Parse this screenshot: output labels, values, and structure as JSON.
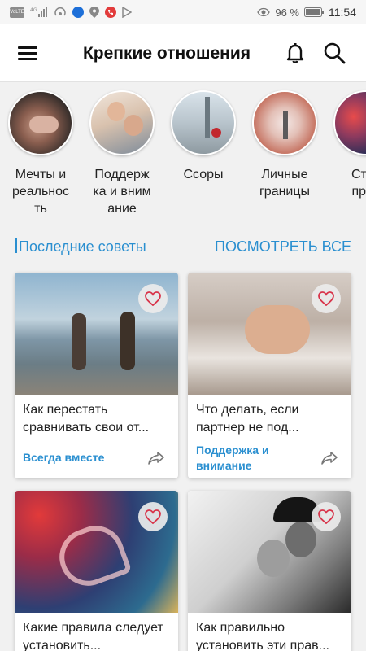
{
  "status_bar": {
    "signal_text": "VoLTE",
    "network": "4G",
    "battery": "96 %",
    "time": "11:54"
  },
  "header": {
    "title": "Крепкие отношения"
  },
  "categories": [
    {
      "label": "Мечты и\nреальнос\nть"
    },
    {
      "label": "Поддерж\nка и вним\nание"
    },
    {
      "label": "Ссоры"
    },
    {
      "label": "Личные\nграницы"
    },
    {
      "label": "Став\nправ"
    }
  ],
  "section": {
    "title": "Последние советы",
    "see_all": "ПОСМОТРЕТЬ ВСЕ"
  },
  "cards": [
    {
      "title": "Как перестать сравнивать свои от...",
      "category": "Всегда вместе"
    },
    {
      "title": "Что делать, если партнер не под...",
      "category": "Поддержка и внимание"
    },
    {
      "title": "Какие правила следует установить...",
      "category": ""
    },
    {
      "title": "Как правильно установить эти прав...",
      "category": ""
    }
  ],
  "colors": {
    "accent": "#2a8fd0",
    "heart": "#d8344a"
  }
}
